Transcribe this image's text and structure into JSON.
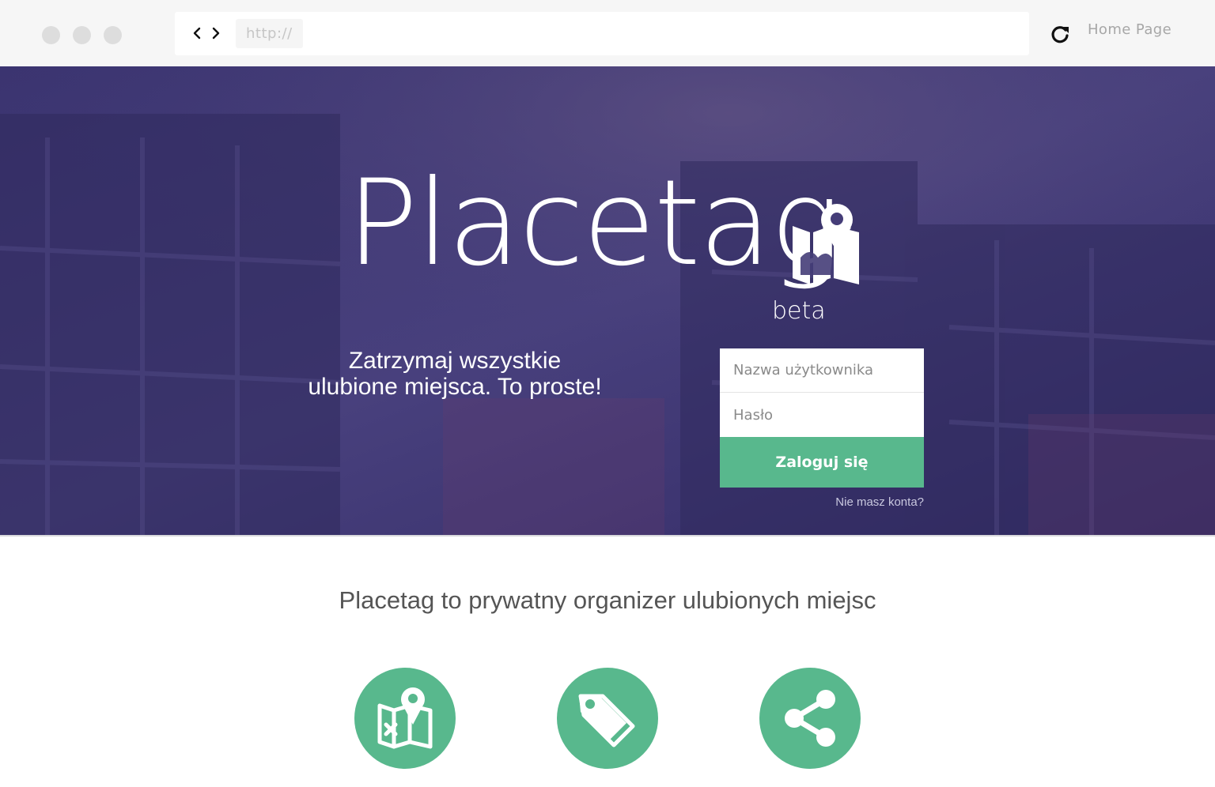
{
  "browser": {
    "url": "http://",
    "home_label": "Home Page"
  },
  "hero": {
    "logo": "Placetag",
    "beta": "beta",
    "tagline_line1": "Zatrzymaj wszystkie",
    "tagline_line2": "ulubione miejsca. To proste!"
  },
  "login": {
    "username_placeholder": "Nazwa użytkownika",
    "password_placeholder": "Hasło",
    "submit_label": "Zaloguj się",
    "signup_link": "Nie masz konta?"
  },
  "content": {
    "subtitle": "Placetag to prywatny organizer ulubionych miejsc",
    "features": [
      {
        "icon": "map-pin-icon"
      },
      {
        "icon": "tag-icon"
      },
      {
        "icon": "share-icon"
      }
    ]
  },
  "colors": {
    "accent": "#58b88d",
    "hero_overlay": "#3f3a78",
    "chrome": "#f6f6f6"
  }
}
